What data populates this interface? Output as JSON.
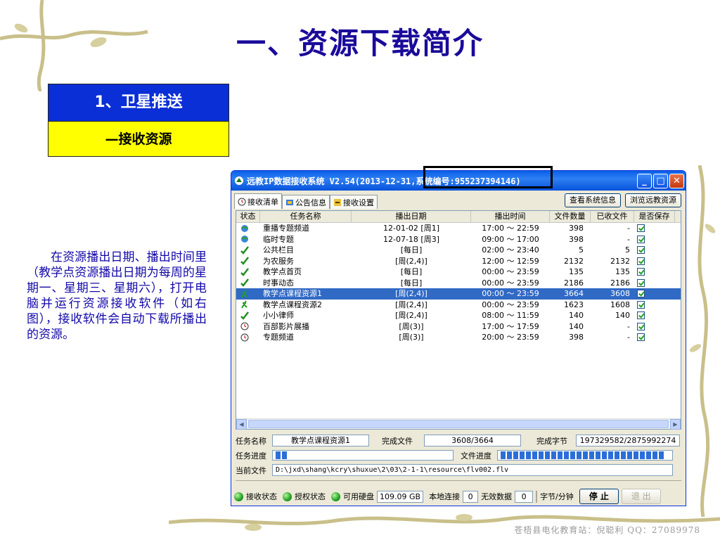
{
  "slide": {
    "title": "一、资源下载简介",
    "section": "1、卫星推送",
    "subsection": "—接收资源",
    "description": "在资源播出日期、播出时间里（教学点资源播出日期为每周的星期一、星期三、星期六），打开电脑并运行资源接收软件（如右图），接收软件会自动下载所播出的资源。",
    "watermark": "苍梧县电化教育站：倪聪利  QQ：27089978"
  },
  "window": {
    "title": "远教IP数据接收系统 V2.54(2013-12-31,系统编号:955237394146)",
    "tabs": [
      "接收清单",
      "公告信息",
      "接收设置"
    ],
    "buttons": [
      "查看系统信息",
      "浏览远教资源"
    ],
    "columns": [
      "状态",
      "任务名称",
      "播出日期",
      "播出时间",
      "文件数量",
      "已收文件",
      "是否保存"
    ],
    "rows": [
      {
        "status": "globe",
        "name": "重播专题频道",
        "date": "12-01-02  [周1]",
        "time": "17:00 ～ 22:59",
        "files": "398",
        "received": "-",
        "save": true
      },
      {
        "status": "globe",
        "name": "临时专题",
        "date": "12-07-18  [周3]",
        "time": "09:00 ～ 17:00",
        "files": "398",
        "received": "-",
        "save": true
      },
      {
        "status": "check",
        "name": "公共栏目",
        "date": "[每日]",
        "time": "02:00 ～ 23:40",
        "files": "5",
        "received": "5",
        "save": true
      },
      {
        "status": "check",
        "name": "为农服务",
        "date": "[周(2,4)]",
        "time": "12:00 ～ 12:59",
        "files": "2132",
        "received": "2132",
        "save": true
      },
      {
        "status": "check",
        "name": "教学点首页",
        "date": "[每日]",
        "time": "00:00 ～ 23:59",
        "files": "135",
        "received": "135",
        "save": true
      },
      {
        "status": "check",
        "name": "时事动态",
        "date": "[每日]",
        "time": "00:00 ～ 23:59",
        "files": "2186",
        "received": "2186",
        "save": true
      },
      {
        "status": "run",
        "name": "教学点课程资源1",
        "date": "[周(2,4)]",
        "time": "00:00 ～ 23:59",
        "files": "3664",
        "received": "3608",
        "save": true,
        "selected": true
      },
      {
        "status": "run",
        "name": "教学点课程资源2",
        "date": "[周(2,4)]",
        "time": "00:00 ～ 23:59",
        "files": "1623",
        "received": "1608",
        "save": true
      },
      {
        "status": "check",
        "name": "小小律师",
        "date": "[周(2,4)]",
        "time": "08:00 ～ 11:59",
        "files": "140",
        "received": "140",
        "save": true
      },
      {
        "status": "clock",
        "name": "百部影片展播",
        "date": "[周(3)]",
        "time": "17:00 ～ 17:59",
        "files": "140",
        "received": "-",
        "save": true
      },
      {
        "status": "clock",
        "name": "专题频道",
        "date": "[周(3)]",
        "time": "20:00 ～ 23:59",
        "files": "398",
        "received": "-",
        "save": true
      }
    ],
    "info": {
      "task_label": "任务名称",
      "task_value": "教学点课程资源1",
      "done_files_label": "完成文件",
      "done_files_value": "3608/3664",
      "done_bytes_label": "完成字节",
      "done_bytes_value": "197329582/2875992274",
      "task_progress_label": "任务进度",
      "file_progress_label": "文件进度",
      "current_file_label": "当前文件",
      "current_file_value": "D:\\jxd\\shang\\kcry\\shuxue\\2\\03\\2-1-1\\resource\\flv002.flv"
    },
    "status": {
      "recv_state": "接收状态",
      "auth_state": "授权状态",
      "disk_label": "可用硬盘",
      "disk_value": "109.09 GB",
      "local_conn_label": "本地连接",
      "local_conn_value": "0",
      "invalid_label": "无效数据",
      "invalid_value": "0",
      "rate_label": "字节/分钟",
      "stop": "停 止",
      "exit": "退 出"
    }
  }
}
